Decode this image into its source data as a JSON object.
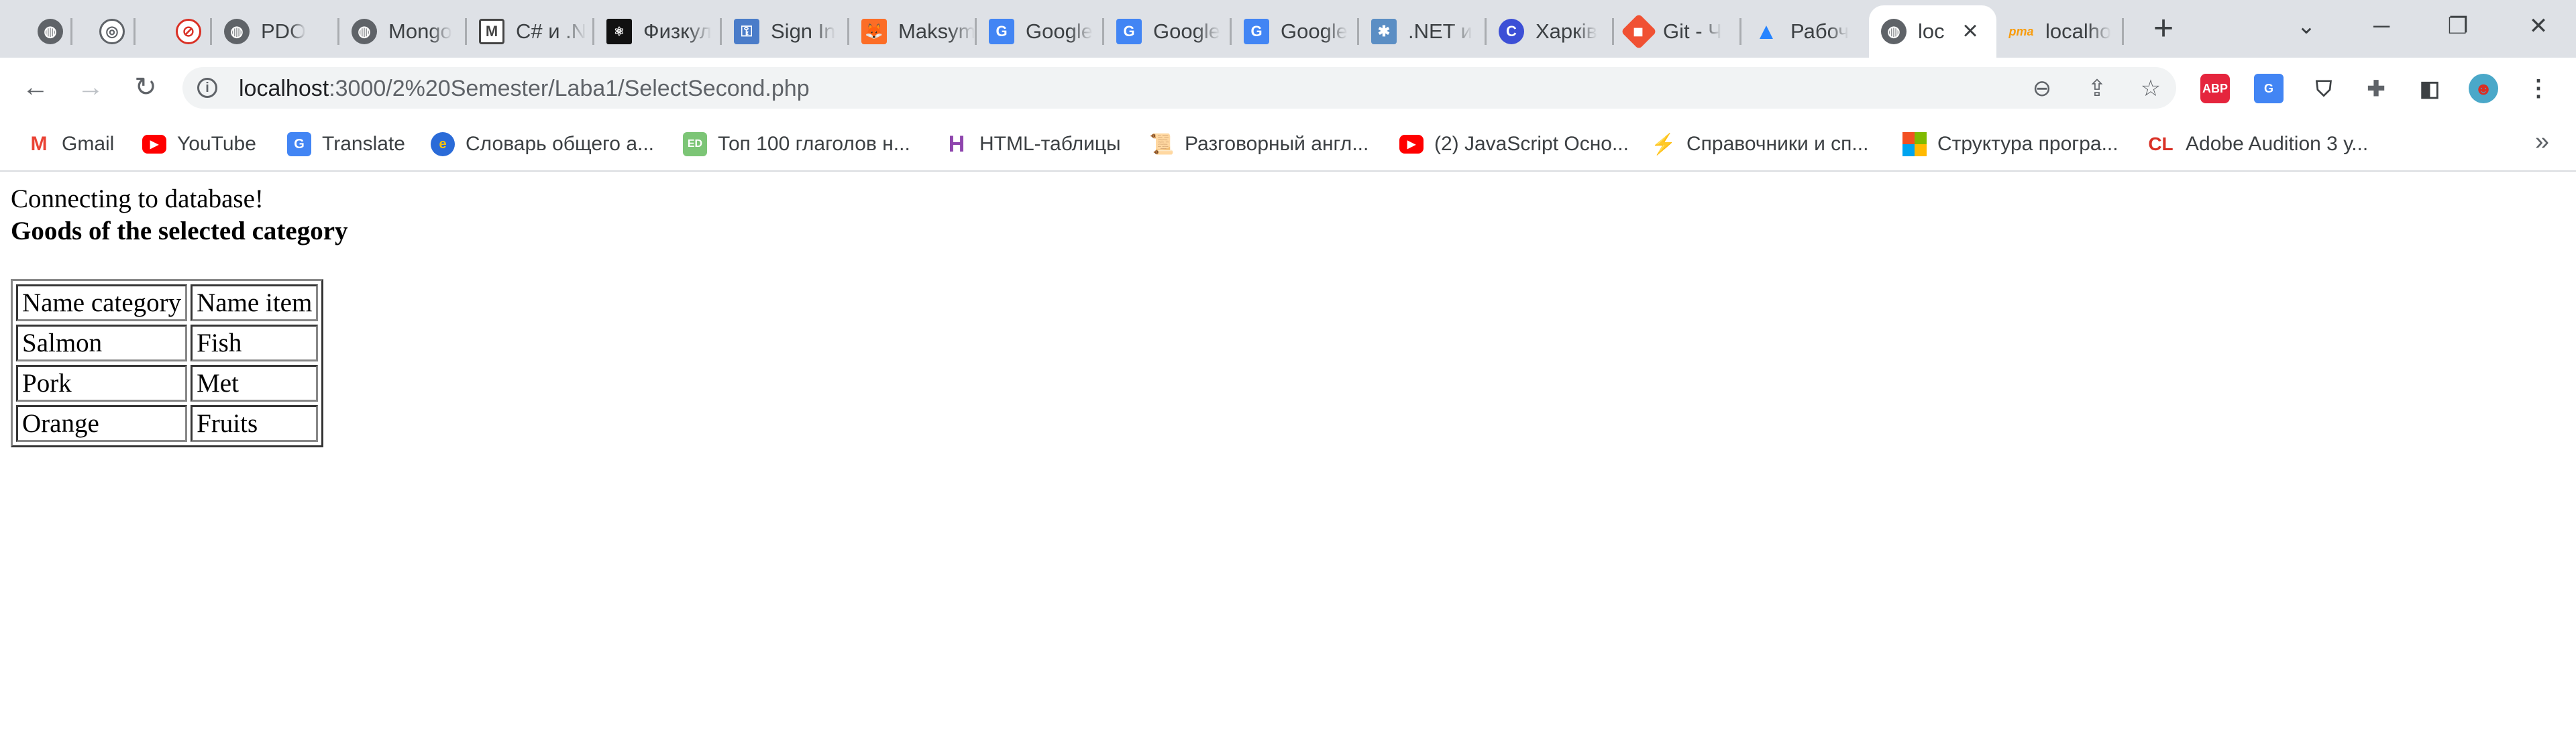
{
  "tabs": [
    {
      "title": "",
      "icon": "globe-icon"
    },
    {
      "title": "",
      "icon": "globe-outline-icon"
    },
    {
      "title": "",
      "icon": "opera-red-icon"
    },
    {
      "title": "PDO",
      "icon": "globe-icon"
    },
    {
      "title": "Mongo",
      "icon": "globe-icon"
    },
    {
      "title": "C# и .N",
      "icon": "gmail-m-icon"
    },
    {
      "title": "Физкул",
      "icon": "physics-icon"
    },
    {
      "title": "Sign In",
      "icon": "key-icon"
    },
    {
      "title": "Maksym",
      "icon": "gitlab-icon"
    },
    {
      "title": "Google",
      "icon": "google-translate-icon"
    },
    {
      "title": "Google",
      "icon": "google-translate-icon"
    },
    {
      "title": "Google",
      "icon": "google-translate-icon"
    },
    {
      "title": ".NET и",
      "icon": "dotnet-icon"
    },
    {
      "title": "Харків",
      "icon": "c-circle-icon"
    },
    {
      "title": "Git - Ч",
      "icon": "git-icon"
    },
    {
      "title": "Рабоч",
      "icon": "atlassian-icon"
    },
    {
      "title": "loc",
      "icon": "globe-icon",
      "active": true
    },
    {
      "title": "localho",
      "icon": "pma-icon"
    }
  ],
  "toolbar": {
    "url_host": "localhost",
    "url_path": ":3000/2%20Semester/Laba1/SelectSecond.php"
  },
  "extensions": {
    "abp": "ABP"
  },
  "bookmarks": [
    {
      "label": "Gmail",
      "icon": "gmail-icon"
    },
    {
      "label": "YouTube",
      "icon": "youtube-icon"
    },
    {
      "label": "Translate",
      "icon": "google-translate-icon"
    },
    {
      "label": "Словарь общего а...",
      "icon": "e-circle-icon"
    },
    {
      "label": "Топ 100 глаголов н...",
      "icon": "ed-icon"
    },
    {
      "label": "HTML-таблицы",
      "icon": "html-tables-icon"
    },
    {
      "label": "Разговорный англ...",
      "icon": "scroll-icon"
    },
    {
      "label": "(2) JavaScript Осно...",
      "icon": "youtube-icon"
    },
    {
      "label": "Справочники и сп...",
      "icon": "tower-icon"
    },
    {
      "label": "Структура програ...",
      "icon": "microsoft-icon"
    },
    {
      "label": "Adobe Audition 3 у...",
      "icon": "cl-icon"
    }
  ],
  "page": {
    "status": "Connecting to database!",
    "heading": "Goods of the selected category",
    "table": {
      "headers": [
        "Name category",
        "Name item"
      ],
      "rows": [
        [
          "Salmon",
          "Fish"
        ],
        [
          "Pork",
          "Met"
        ],
        [
          "Orange",
          "Fruits"
        ]
      ]
    }
  },
  "colors": {
    "tabstrip": "#dee1e6",
    "omnibox": "#f1f3f4",
    "youtube_red": "#ff0000",
    "abp_red": "#e5253d"
  }
}
